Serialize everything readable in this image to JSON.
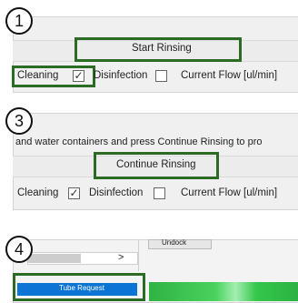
{
  "panel1": {
    "step": "1",
    "button_label": "Start Rinsing",
    "cleaning_label": "Cleaning",
    "cleaning_checked": true,
    "checkmark": "✓",
    "disinfection_label": "Disinfection",
    "disinfection_checked": false,
    "current_flow_label": "Current Flow [ul/min]"
  },
  "panel3": {
    "step": "3",
    "instruction": "and water containers and press Continue Rinsing to pro",
    "button_label": "Continue Rinsing",
    "cleaning_label": "Cleaning",
    "cleaning_checked": true,
    "checkmark": "✓",
    "disinfection_label": "Disinfection",
    "disinfection_checked": false,
    "current_flow_label": "Current Flow [ul/min]"
  },
  "panel4": {
    "step": "4",
    "undock_label": "Undock",
    "scroll_arrow": ">",
    "tube_request_label": "Tube Request"
  },
  "colors": {
    "highlight": "#2c6b23",
    "tube_request_bg": "#0b74d4",
    "progress_green": "#34c24a"
  }
}
